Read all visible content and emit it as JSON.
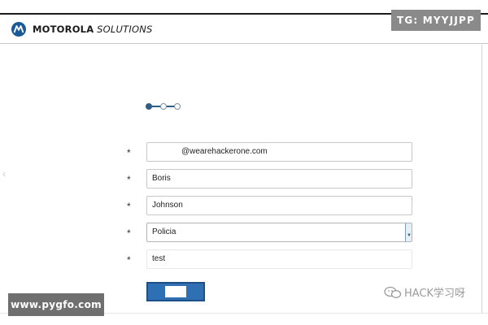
{
  "overlays": {
    "top_right_badge": "TG: MYYJJPP",
    "bottom_left_badge": "www.pygfo.com",
    "watermark": "HACK学习呀"
  },
  "header": {
    "brand": "MOTOROLA",
    "brand_sub": "SOLUTIONS",
    "logo_icon": "motorola-m-logo",
    "brand_color": "#1a5a96"
  },
  "stepper": {
    "total_steps": 3,
    "current_step": 1,
    "active_color": "#2f5d8a"
  },
  "form": {
    "required_marker": "*",
    "fields": [
      {
        "name": "email",
        "value": "@wearehackerone.com"
      },
      {
        "name": "first_name",
        "value": "Boris"
      },
      {
        "name": "last_name",
        "value": "Johnson"
      },
      {
        "name": "role",
        "value": "Policia",
        "type": "select"
      },
      {
        "name": "password",
        "value": "test"
      }
    ],
    "submit_label": "",
    "submit_color": "#2f6fb3"
  }
}
